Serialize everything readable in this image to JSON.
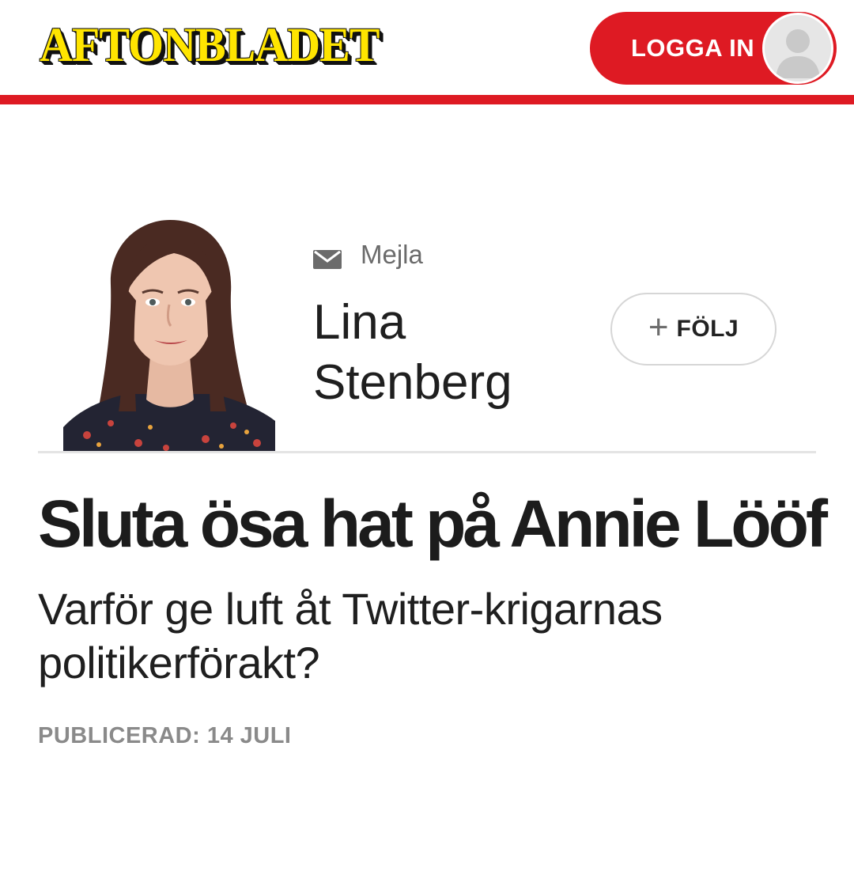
{
  "header": {
    "logo_text": "AFTONBLADET",
    "login_label": "LOGGA IN",
    "brand_yellow": "#ffe500",
    "brand_red": "#de1a23"
  },
  "author": {
    "mail_label": "Mejla",
    "name_first": "Lina",
    "name_last": "Stenberg",
    "follow_label": "FÖLJ"
  },
  "article": {
    "headline": "Sluta ösa hat på Annie Lööf",
    "subheadline": "Varför ge luft åt Twitter-krigarnas politikerförakt?",
    "published": "PUBLICERAD: 14 JULI"
  },
  "icons": {
    "mail": "envelope-icon",
    "avatar": "user-avatar-icon",
    "plus": "plus-icon"
  }
}
